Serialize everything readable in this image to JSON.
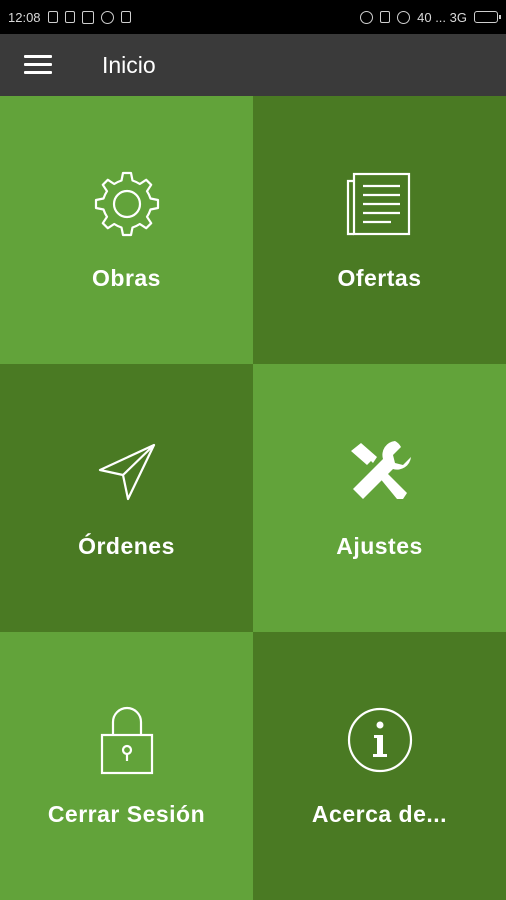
{
  "status_bar": {
    "time": "12:08",
    "signal_text": "40 ... 3G",
    "icons": [
      "sim-icon",
      "phone-icon",
      "wifi-like-icon",
      "whatsapp-icon",
      "shield-icon",
      "moon-icon",
      "bluetooth-icon",
      "alarm-icon",
      "signal-icon",
      "battery-icon"
    ]
  },
  "app_bar": {
    "title": "Inicio",
    "background": "#3a3a3a"
  },
  "tiles": [
    {
      "label": "Obras",
      "icon": "gear-icon",
      "color": "#62a33a"
    },
    {
      "label": "Ofertas",
      "icon": "newspaper-icon",
      "color": "#4a7a23"
    },
    {
      "label": "Órdenes",
      "icon": "send-icon",
      "color": "#4a7a23"
    },
    {
      "label": "Ajustes",
      "icon": "tools-icon",
      "color": "#62a33a"
    },
    {
      "label": "Cerrar Sesión",
      "icon": "lock-icon",
      "color": "#62a33a"
    },
    {
      "label": "Acerca de...",
      "icon": "info-icon",
      "color": "#4a7a23"
    }
  ]
}
